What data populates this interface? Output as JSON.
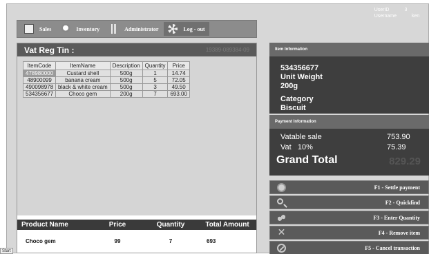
{
  "user": {
    "userid_label": "UserID",
    "userid_value": "3",
    "username_label": "Username",
    "username_value": "ken"
  },
  "toolbar": {
    "items": [
      {
        "label": "Sales",
        "icon": "document-icon"
      },
      {
        "label": "Inventory",
        "icon": "inventory-icon"
      },
      {
        "label": "Administrator",
        "icon": "admin-icon"
      },
      {
        "label": "Log - out",
        "icon": "logout-icon"
      }
    ]
  },
  "vat": {
    "label": "Vat Reg Tin :",
    "value": "19389-089384-09"
  },
  "items_table": {
    "headers": [
      "ItemCode",
      "ItemName",
      "Description",
      "Quantity",
      "Price"
    ],
    "rows": [
      [
        "478980000",
        "Custard shell",
        "500g",
        "1",
        "14.74"
      ],
      [
        "48900099",
        "banana cream",
        "500g",
        "5",
        "72.05"
      ],
      [
        "490098978",
        "black & white cream",
        "500g",
        "3",
        "49.50"
      ],
      [
        "534356677",
        "Choco gem",
        "200g",
        "7",
        "693.00"
      ]
    ]
  },
  "product": {
    "headers": {
      "name": "Product Name",
      "price": "Price",
      "quantity": "Quantity",
      "total": "Total Amount"
    },
    "name": "Choco gem",
    "price": "99",
    "quantity": "7",
    "total": "693"
  },
  "item_info": {
    "title": "Item Information",
    "code": "534356677",
    "unit_weight_label": "Unit Weight",
    "unit_weight": "200g",
    "category_label": "Category",
    "category": "Biscuit"
  },
  "payment": {
    "title": "Payment Information",
    "vatable_label": "Vatable sale",
    "vatable_value": "753.90",
    "vat_label": "Vat   10%",
    "vat_value": "75.39",
    "grand_total_label": "Grand Total",
    "grand_total_value": "829.29"
  },
  "fkeys": [
    {
      "label": "F1 - Settle payment",
      "icon": "calculator-icon"
    },
    {
      "label": "F2 - Quickfind",
      "icon": "magnifier-icon"
    },
    {
      "label": "F3 - Enter Quantity",
      "icon": "quantity-icon"
    },
    {
      "label": "F4 - Remove item",
      "icon": "remove-icon"
    },
    {
      "label": "F5 - Cancel transaction",
      "icon": "cancel-icon"
    }
  ],
  "taskbar": {
    "start_label": "Start"
  }
}
